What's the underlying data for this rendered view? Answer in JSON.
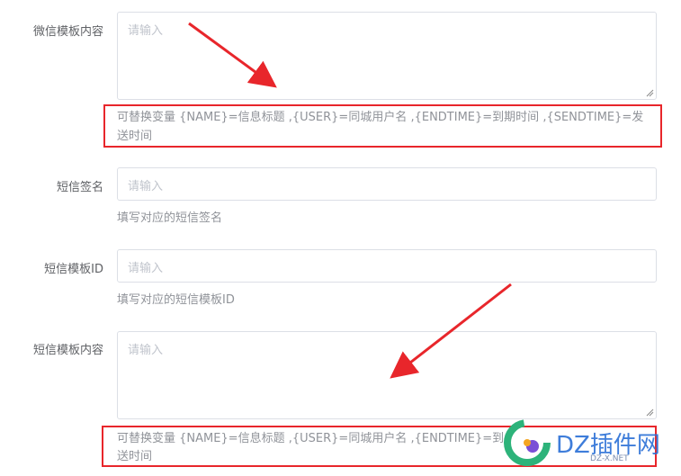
{
  "wechat_template": {
    "label": "微信模板内容",
    "placeholder": "请输入",
    "hint_line1": "可替换变量  {NAME}=信息标题  ,{USER}=同城用户名  ,{ENDTIME}=到期时间  ,{SENDTIME}=发",
    "hint_line2": "送时间"
  },
  "sms_sign": {
    "label": "短信签名",
    "placeholder": "请输入",
    "hint": "填写对应的短信签名"
  },
  "sms_template_id": {
    "label": "短信模板ID",
    "placeholder": "请输入",
    "hint": "填写对应的短信模板ID"
  },
  "sms_template": {
    "label": "短信模板内容",
    "placeholder": "请输入",
    "hint_line1": "可替换变量  {NAME}=信息标题  ,{USER}=同城用户名  ,{ENDTIME}=到",
    "hint_line2": "送时间"
  },
  "watermark": {
    "text": "DZ插件网",
    "sub": "DZ-X.NET"
  },
  "colors": {
    "annotation_red": "#e8262b",
    "border": "#dcdfe6",
    "placeholder": "#c0c4cc"
  }
}
